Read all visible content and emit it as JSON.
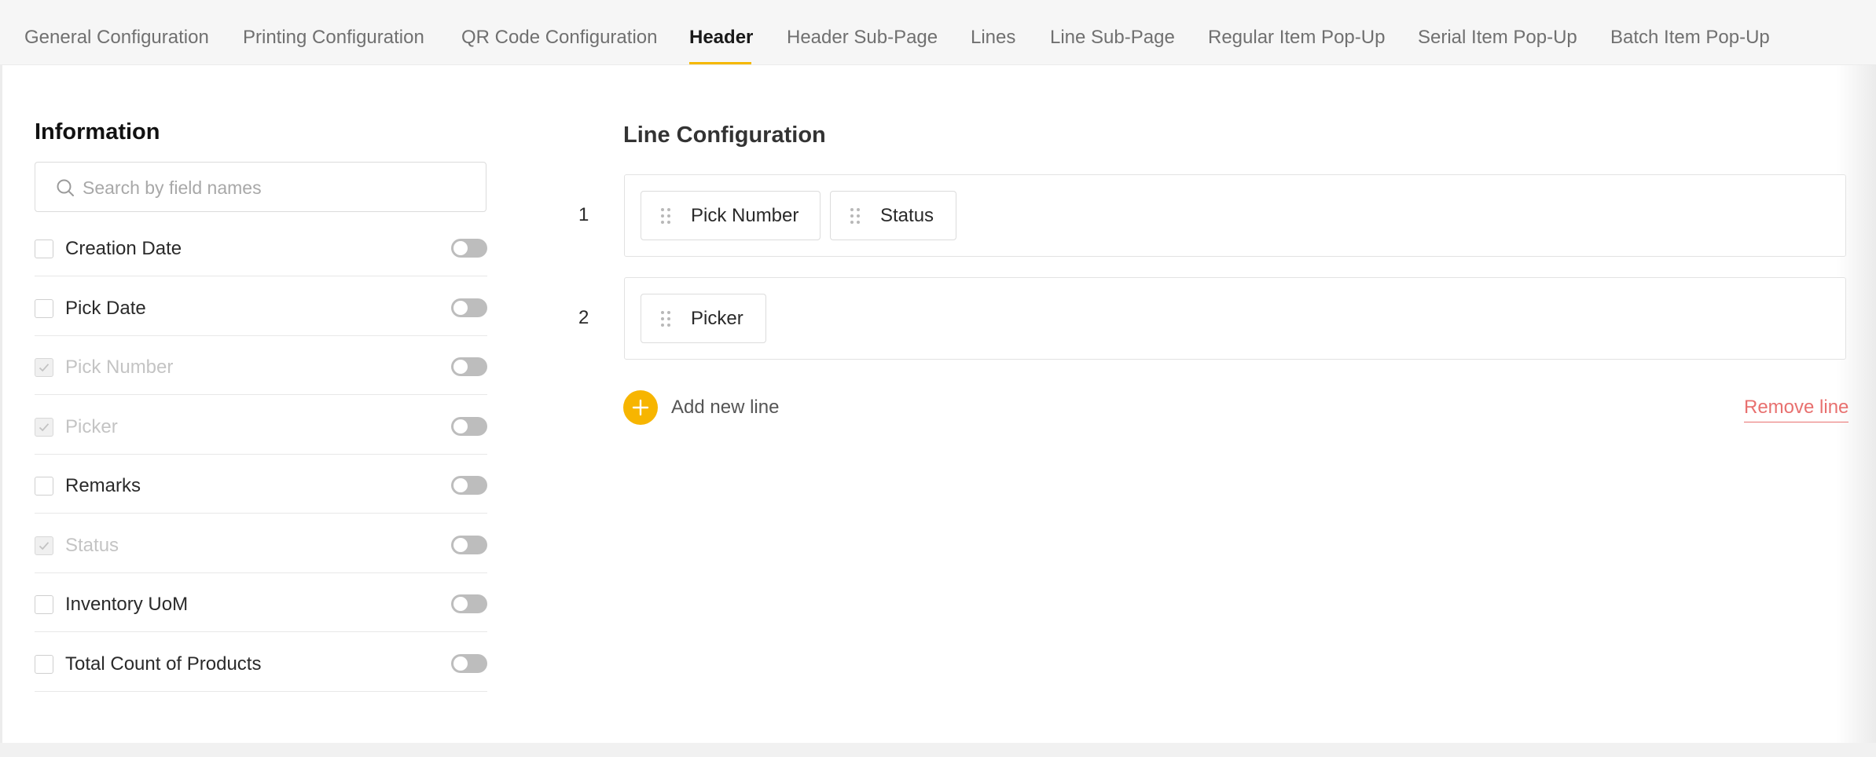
{
  "tabs": [
    {
      "label": "General Configuration",
      "active": false
    },
    {
      "label": "Printing Configuration",
      "active": false
    },
    {
      "label": "QR Code Configuration",
      "active": false
    },
    {
      "label": "Header",
      "active": true
    },
    {
      "label": "Header Sub-Page",
      "active": false
    },
    {
      "label": "Lines",
      "active": false
    },
    {
      "label": "Line Sub-Page",
      "active": false
    },
    {
      "label": "Regular Item Pop-Up",
      "active": false
    },
    {
      "label": "Serial Item Pop-Up",
      "active": false
    },
    {
      "label": "Batch Item Pop-Up",
      "active": false
    }
  ],
  "information": {
    "title": "Information",
    "search_placeholder": "Search by field names",
    "fields": [
      {
        "label": "Creation Date",
        "checked": false,
        "disabled": false,
        "toggle_on": false
      },
      {
        "label": "Pick Date",
        "checked": false,
        "disabled": false,
        "toggle_on": false
      },
      {
        "label": "Pick Number",
        "checked": true,
        "disabled": true,
        "toggle_on": false
      },
      {
        "label": "Picker",
        "checked": true,
        "disabled": true,
        "toggle_on": false
      },
      {
        "label": "Remarks",
        "checked": false,
        "disabled": false,
        "toggle_on": false
      },
      {
        "label": "Status",
        "checked": true,
        "disabled": true,
        "toggle_on": false
      },
      {
        "label": "Inventory UoM",
        "checked": false,
        "disabled": false,
        "toggle_on": false
      },
      {
        "label": "Total Count of Products",
        "checked": false,
        "disabled": false,
        "toggle_on": false
      }
    ]
  },
  "line_configuration": {
    "title": "Line Configuration",
    "lines": [
      {
        "number": "1",
        "fields": [
          "Pick Number",
          "Status"
        ]
      },
      {
        "number": "2",
        "fields": [
          "Picker"
        ]
      }
    ],
    "add_line_label": "Add new line",
    "remove_line_label": "Remove line"
  },
  "colors": {
    "accent": "#f7b500",
    "danger": "#e8706f",
    "toggle_off": "#bdbdbd"
  }
}
